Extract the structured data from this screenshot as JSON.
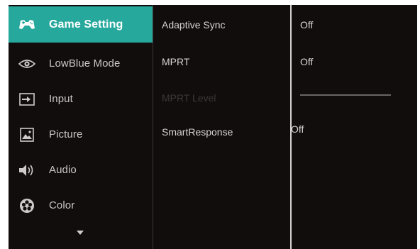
{
  "sidebar": {
    "items": [
      {
        "label": "Game Setting",
        "icon": "gamepad-icon"
      },
      {
        "label": "LowBlue Mode",
        "icon": "eye-icon"
      },
      {
        "label": "Input",
        "icon": "input-icon"
      },
      {
        "label": "Picture",
        "icon": "picture-icon"
      },
      {
        "label": "Audio",
        "icon": "speaker-icon"
      },
      {
        "label": "Color",
        "icon": "color-wheel-icon"
      }
    ],
    "more_icon": "chevron-down-icon"
  },
  "submenu": {
    "items": [
      {
        "label": "Adaptive Sync",
        "value": "Off"
      },
      {
        "label": "MPRT",
        "value": "Off"
      },
      {
        "label": "MPRT Level",
        "level": 0
      },
      {
        "label": "SmartResponse",
        "value": "Off"
      }
    ]
  },
  "colors": {
    "accent": "#27a89d",
    "background": "#120d0d",
    "text": "#d6d3d3",
    "disabled_text": "#3d3838"
  }
}
